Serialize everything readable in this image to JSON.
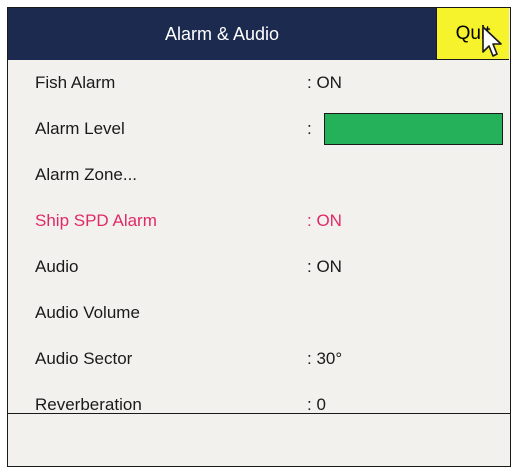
{
  "window": {
    "title": "Alarm & Audio",
    "quit_label": "Quit"
  },
  "colors": {
    "title_bg": "#1b2a4e",
    "quit_bg": "#f6f32c",
    "selected_text": "#e02a66",
    "level_fill": "#25b15a"
  },
  "menu": {
    "items": [
      {
        "label": "Fish Alarm",
        "value": ": ON"
      },
      {
        "label": "Alarm Level",
        "value": ":",
        "level_fraction": 1.0
      },
      {
        "label": "Alarm Zone...",
        "value": ""
      },
      {
        "label": "Ship SPD Alarm",
        "value": ": ON",
        "selected": true
      },
      {
        "label": "Audio",
        "value": ": ON"
      },
      {
        "label": "Audio Volume",
        "value": ""
      },
      {
        "label": "Audio Sector",
        "value": ": 30°"
      },
      {
        "label": "Reverberation",
        "value": ": 0"
      }
    ]
  },
  "cursor": {
    "icon": "mouse-pointer-icon"
  }
}
